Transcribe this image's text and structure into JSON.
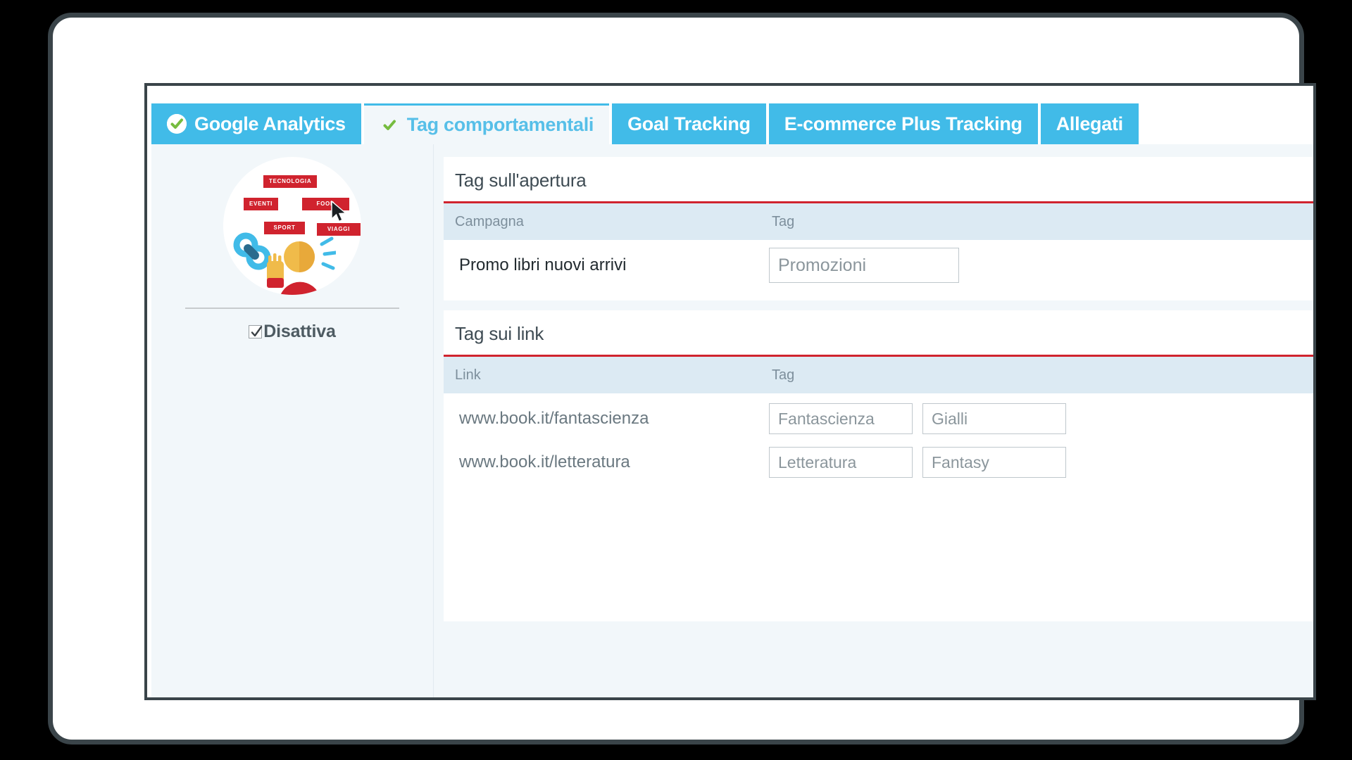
{
  "tabs": [
    {
      "label": "Google Analytics",
      "icon": "check-circle-icon",
      "active": false,
      "checked": true
    },
    {
      "label": "Tag comportamentali",
      "icon": "check-circle-icon",
      "active": true,
      "checked": true
    },
    {
      "label": "Goal Tracking",
      "icon": "",
      "active": false,
      "checked": false
    },
    {
      "label": "E-commerce Plus Tracking",
      "icon": "",
      "active": false,
      "checked": false
    },
    {
      "label": "Allegati",
      "icon": "",
      "active": false,
      "checked": false
    }
  ],
  "sidebar": {
    "help_icon": "help-circle-icon",
    "illustration": {
      "chips": [
        "TECNOLOGIA",
        "EVENTI",
        "FOOD",
        "SPORT",
        "VIAGGI"
      ],
      "cursor_icon": "mouse-cursor-icon",
      "chain_icon": "link-chain-icon",
      "person_icon": "person-icon"
    },
    "disattiva": {
      "label": "Disattiva",
      "checked": true,
      "icon": "checkbox-checked-icon"
    }
  },
  "sections": {
    "apertura": {
      "title": "Tag sull'apertura",
      "columns": [
        "Campagna",
        "Tag"
      ],
      "rows": [
        {
          "label": "Promo libri nuovi arrivi",
          "tags": [
            "Promozioni"
          ]
        }
      ]
    },
    "link": {
      "title": "Tag sui link",
      "columns": [
        "Link",
        "Tag"
      ],
      "rows": [
        {
          "label": "www.book.it/fantascienza",
          "tags": [
            "Fantascienza",
            "Gialli"
          ]
        },
        {
          "label": "www.book.it/letteratura",
          "tags": [
            "Letteratura",
            "Fantasy"
          ]
        }
      ]
    }
  },
  "colors": {
    "tab_blue": "#41bbe8",
    "tab_active_text": "#57bfe8",
    "accent_red": "#d0232e",
    "chip_red": "#d0232e",
    "table_head": "#dceaf3",
    "panel_bg": "#f2f7fa",
    "bezel": "#3a4449"
  }
}
